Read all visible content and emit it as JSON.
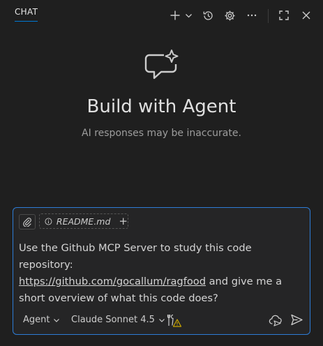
{
  "header": {
    "tab_label": "CHAT",
    "icons": [
      "plus-icon",
      "chevron-down-icon",
      "history-icon",
      "gear-icon",
      "more-icon",
      "maximize-icon",
      "close-icon"
    ]
  },
  "welcome": {
    "title": "Build with Agent",
    "subtitle": "AI responses may be inaccurate.",
    "icon": "chat-sparkle-icon"
  },
  "input": {
    "context_chip": {
      "label": "README.md",
      "icon": "info-icon"
    },
    "prompt": {
      "line1": "Use the Github MCP Server to study this code",
      "line2": "repository:",
      "link": "https://github.com/gocallum/ragfood",
      "line3_rest": " and give me a",
      "line4": "short overview of what this code does?"
    },
    "footer": {
      "mode": "Agent",
      "model": "Claude Sonnet 4.5"
    }
  },
  "colors": {
    "background": "#1f1f1f",
    "accent": "#0078d4",
    "warning": "#cca700"
  }
}
